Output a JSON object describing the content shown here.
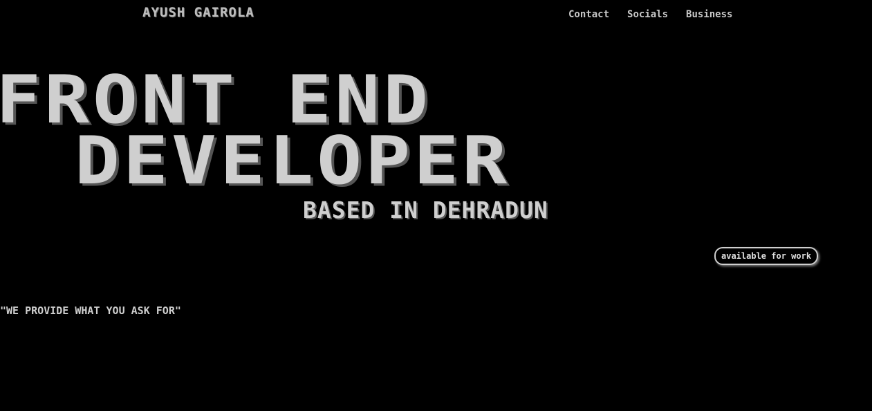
{
  "header": {
    "brand": "AYUSH GAIROLA",
    "nav": [
      {
        "label": "Contact"
      },
      {
        "label": "Socials"
      },
      {
        "label": "Business"
      }
    ]
  },
  "hero": {
    "line1": "FRONT END",
    "line2": "DEVELOPER",
    "location": "BASED IN DEHRADUN"
  },
  "status_badge": "available for work",
  "tagline": "\"WE PROVIDE WHAT YOU ASK FOR\"",
  "colors": {
    "background": "#000000",
    "text": "#cfcfcf",
    "shadow": "#555555"
  }
}
